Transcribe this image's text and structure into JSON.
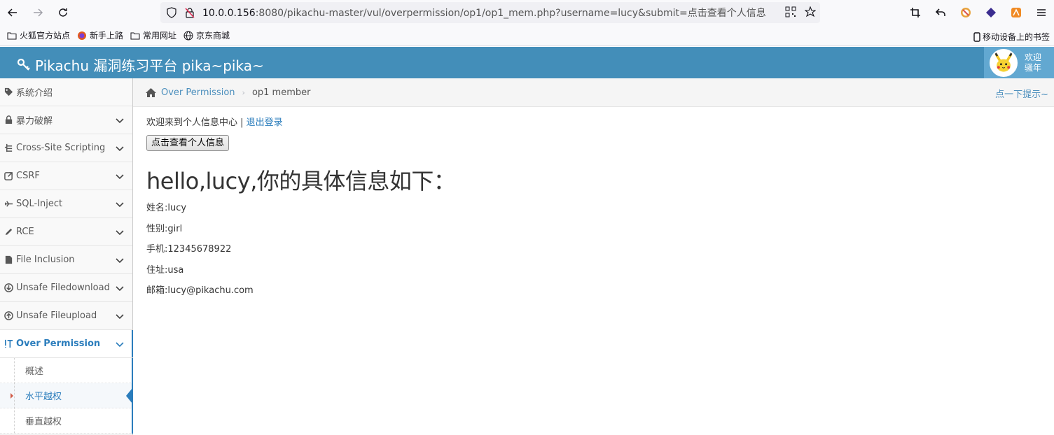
{
  "browser": {
    "url_host": "10.0.0.156",
    "url_rest": ":8080/pikachu-master/vul/overpermission/op1/op1_mem.php?username=lucy&submit=点击查看个人信息"
  },
  "bookmarks": {
    "items": [
      "火狐官方站点",
      "新手上路",
      "常用网址",
      "京东商城"
    ],
    "mobile": "移动设备上的书签"
  },
  "app": {
    "title": "Pikachu 漏洞练习平台 pika~pika~",
    "user_line1": "欢迎",
    "user_line2": "骚年"
  },
  "sidebar": {
    "items": [
      {
        "label": "系统介绍",
        "icon": "tags-icon"
      },
      {
        "label": "暴力破解",
        "icon": "lock-icon"
      },
      {
        "label": "Cross-Site Scripting",
        "icon": "list-icon"
      },
      {
        "label": "CSRF",
        "icon": "share-icon"
      },
      {
        "label": "SQL-Inject",
        "icon": "fighter-jet-icon"
      },
      {
        "label": "RCE",
        "icon": "pencil-icon"
      },
      {
        "label": "File Inclusion",
        "icon": "file-icon"
      },
      {
        "label": "Unsafe Filedownload",
        "icon": "download-icon"
      },
      {
        "label": "Unsafe Fileupload",
        "icon": "upload-icon"
      },
      {
        "label": "Over Permission",
        "icon": "text-height-icon"
      }
    ],
    "sub_items": [
      "概述",
      "水平越权",
      "垂直越权"
    ]
  },
  "breadcrumb": {
    "link": "Over Permission",
    "current": "op1 member",
    "tip": "点一下提示~"
  },
  "content": {
    "welcome": "欢迎来到个人信息中心 | ",
    "logout": "退出登录",
    "button": "点击查看个人信息",
    "hello": "hello,lucy,你的具体信息如下：",
    "info": [
      "姓名:lucy",
      "性别:girl",
      "手机:12345678922",
      "住址:usa",
      "邮箱:lucy@pikachu.com"
    ]
  }
}
